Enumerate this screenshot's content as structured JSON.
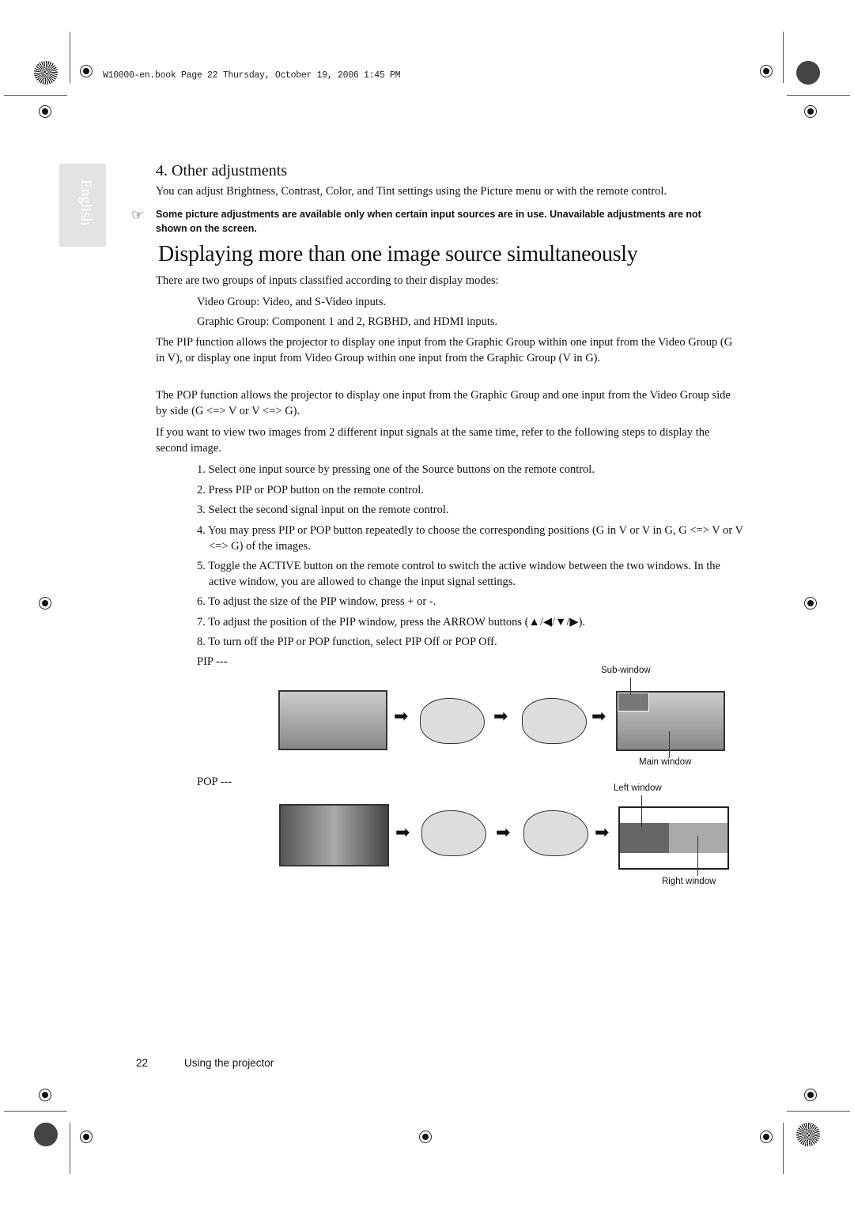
{
  "header": {
    "print_info": "W10000-en.book  Page 22  Thursday, October 19, 2006  1:45 PM"
  },
  "side_tab": {
    "label": "English"
  },
  "section": {
    "title": "4. Other adjustments",
    "body": "You can adjust Brightness, Contrast, Color, and Tint settings using the Picture menu or with the remote control.",
    "note": "Some picture adjustments are available only when certain input sources are in use. Unavailable adjustments are not shown on the screen."
  },
  "main": {
    "title": "Displaying more than one image source simultaneously",
    "intro": "There are two groups of inputs classified according to their display modes:",
    "group_video": "Video Group: Video, and S-Video inputs.",
    "group_graphic": "Graphic Group: Component 1 and 2, RGBHD, and HDMI inputs.",
    "pip_para": "The PIP function allows the projector to display one input from the Graphic Group within one input from the Video Group (G in V), or display one input from Video Group within one input from the Graphic Group (V in G).",
    "pop_para": "The POP function allows the projector to display one input from the Graphic Group and one input from the Video Group side by side (G <=> V or V <=> G).",
    "steps_intro": "If you want to view two images from 2 different input signals at the same time, refer to the following steps to display the second image.",
    "steps": [
      "1. Select one input source by pressing one of the Source buttons on the remote control.",
      "2. Press PIP or POP button on the remote control.",
      "3. Select the second signal input on the remote control.",
      "4. You may press PIP or POP button repeatedly to choose the corresponding positions (G in V or V in G, G <=> V or V <=> G) of the images.",
      "5. Toggle the ACTIVE button on the remote control to switch the active window between the two windows. In the active window, you are allowed to change the input signal settings.",
      "6. To adjust the size of the PIP window, press + or -.",
      "7. To adjust the position of the PIP window, press the ARROW buttons (▲/◀/▼/▶).",
      "8. To turn off the PIP or POP function, select PIP Off or POP Off."
    ]
  },
  "figure": {
    "pip_label": "PIP ---",
    "pop_label": "POP ---",
    "sub_window": "Sub-window",
    "main_window": "Main window",
    "left_window": "Left window",
    "right_window": "Right window",
    "arrow": "➡"
  },
  "footer": {
    "page_number": "22",
    "section": "Using the projector"
  }
}
